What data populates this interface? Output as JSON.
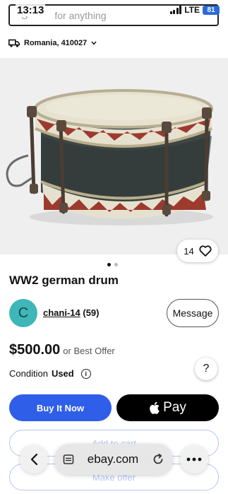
{
  "status": {
    "time": "13:13",
    "network": "LTE",
    "battery": "81"
  },
  "search": {
    "placeholder_partial": "S",
    "placeholder": "for anything"
  },
  "location": {
    "text": "Romania, 410027"
  },
  "listing": {
    "photo_count": "14",
    "photo_dots": 2,
    "title": "WW2 german drum",
    "seller": {
      "initial": "C",
      "name": "chani-14",
      "score": "(59)"
    },
    "price": "$500.00",
    "offer_note": "or Best Offer",
    "condition_label": "Condition",
    "condition_value": "Used"
  },
  "actions": {
    "message": "Message",
    "buy_now": "Buy It Now",
    "pay": "Pay",
    "add_to_cart": "Add to cart",
    "make_offer": "Make offer",
    "help": "?"
  },
  "browser": {
    "url": "ebay.com"
  },
  "icons": [
    "truck-icon",
    "chevron-down-icon",
    "heart-icon",
    "info-icon",
    "apple-icon",
    "back-icon",
    "tabs-icon",
    "reload-icon",
    "more-icon"
  ],
  "colors": {
    "accent": "#2f5ee8",
    "avatar": "#3fb6b7"
  }
}
